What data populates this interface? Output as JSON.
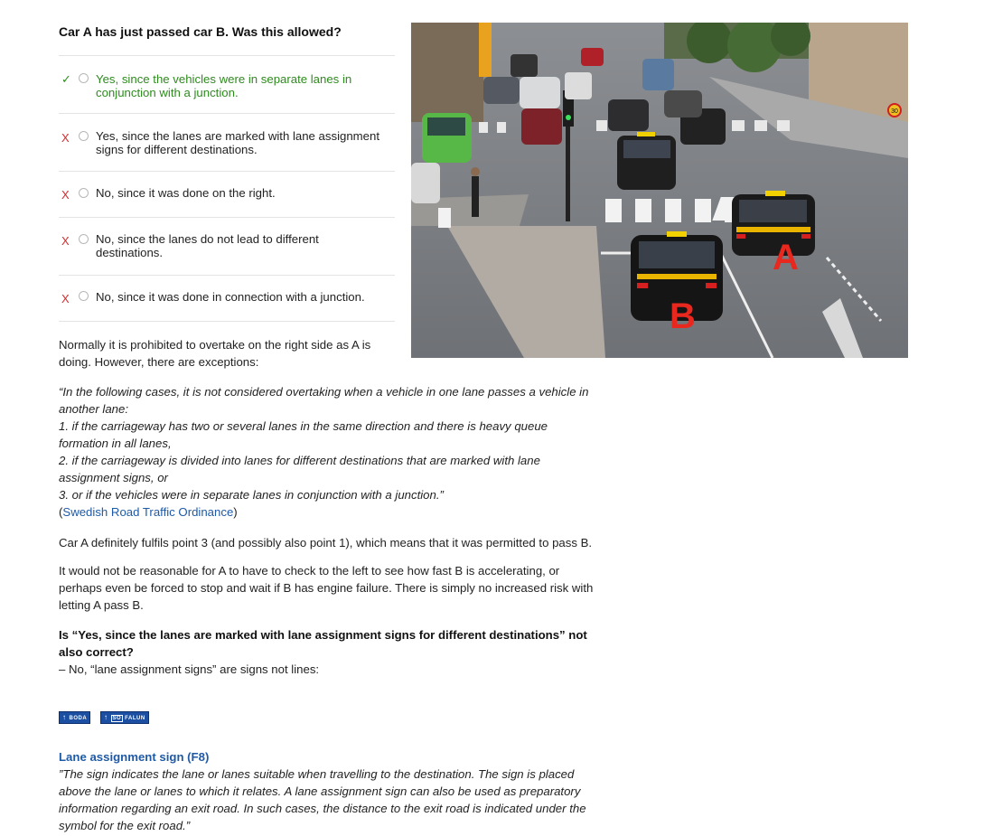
{
  "question": "Car A has just passed car B. Was this allowed?",
  "options": [
    {
      "mark": "✓",
      "status": "correct",
      "text": "Yes, since the vehicles were in separate lanes in conjunction with a junction."
    },
    {
      "mark": "X",
      "status": "wrong",
      "text": "Yes, since the lanes are marked with lane assignment signs for different destinations."
    },
    {
      "mark": "X",
      "status": "wrong",
      "text": "No, since it was done on the right."
    },
    {
      "mark": "X",
      "status": "wrong",
      "text": "No, since the lanes do not lead to different destinations."
    },
    {
      "mark": "X",
      "status": "wrong",
      "text": "No, since it was done in connection with a junction."
    }
  ],
  "photo": {
    "label_a": "A",
    "label_b": "B",
    "speed_sign": "30"
  },
  "explanation": {
    "p1": "Normally it is prohibited to overtake on the right side as A is doing. However, there are exceptions:",
    "quote_lines": [
      "“In the following cases, it is not considered overtaking when a vehicle in one lane passes a vehicle in",
      "another lane:",
      "1. if the carriageway has two or several lanes in the same direction and there is heavy queue",
      "formation in all lanes,",
      "2. if the carriageway is divided into lanes for different destinations that are marked with lane",
      "assignment signs, or",
      "3. or if the vehicles were in separate lanes in conjunction with a junction.”"
    ],
    "source_open": "(",
    "source_link": "Swedish Road Traffic Ordinance",
    "source_close": ")",
    "p2": "Car A definitely fulfils point 3 (and possibly also point 1), which means that it was permitted to pass B.",
    "p3_lines": [
      "It would not be reasonable for A to have to check to the left to see how fast B is accelerating, or",
      "perhaps even be forced to stop and wait if B has engine failure. There is simply no increased risk with",
      "letting A pass B."
    ],
    "q_lines": [
      "Is “Yes, since the lanes are marked with lane assignment signs for different destinations” not",
      "also correct?"
    ],
    "answer": "– No, “lane assignment signs” are signs not lines:",
    "sign1": "BODA",
    "sign2_so": "SO",
    "sign2": "FALUN",
    "lane_title": "Lane assignment sign (F8)",
    "lane_quote_lines": [
      "”The sign indicates the lane or lanes suitable when travelling to the destination. The sign is placed",
      "above the lane or lanes to which it relates. A lane assignment sign can also be used as preparatory",
      "information regarding an exit road. In such cases, the distance to the exit road is indicated under the",
      "symbol for the exit road.”"
    ]
  }
}
